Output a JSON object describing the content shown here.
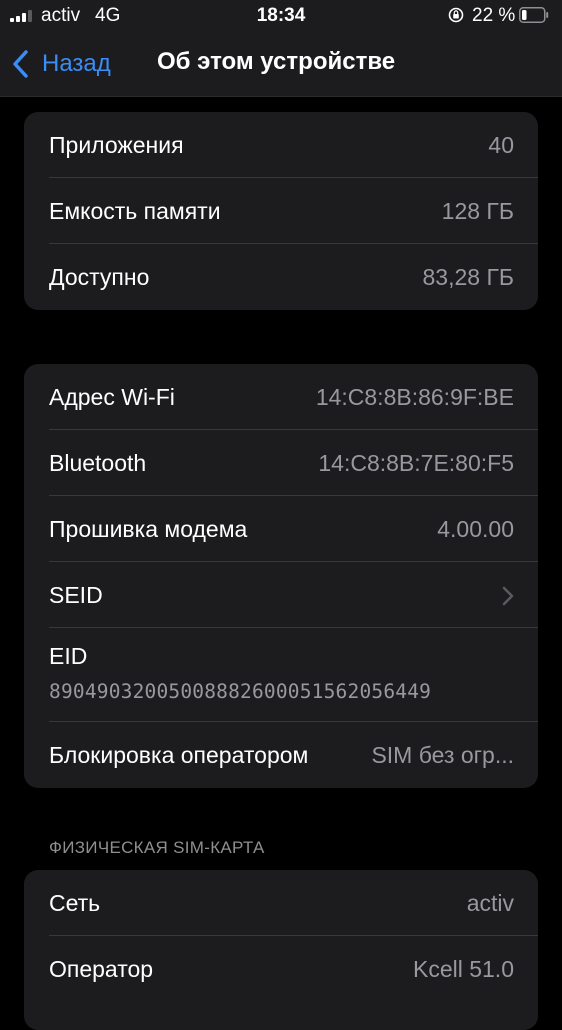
{
  "status_bar": {
    "carrier": "activ",
    "network": "4G",
    "time": "18:34",
    "battery": "22 %",
    "battery_level": 0.22,
    "signal_bars": 3,
    "lock_icon": "orientation-lock-icon"
  },
  "nav": {
    "back_label": "Назад",
    "title": "Об этом устройстве",
    "back_icon": "chevron-left-icon"
  },
  "group1": {
    "rows": [
      {
        "label": "Приложения",
        "value": "40"
      },
      {
        "label": "Емкость памяти",
        "value": "128 ГБ"
      },
      {
        "label": "Доступно",
        "value": "83,28 ГБ"
      }
    ]
  },
  "group2": {
    "rows": [
      {
        "label": "Адрес Wi-Fi",
        "value": "14:C8:8B:86:9F:BE"
      },
      {
        "label": "Bluetooth",
        "value": "14:C8:8B:7E:80:F5"
      },
      {
        "label": "Прошивка модема",
        "value": "4.00.00"
      },
      {
        "label": "SEID",
        "value": ""
      },
      {
        "label": "EID",
        "value": "89049032005008882600051562056449"
      },
      {
        "label": "Блокировка оператором",
        "value": "SIM без огр..."
      }
    ]
  },
  "sim_section": {
    "header": "ФИЗИЧЕСКАЯ SIM-КАРТА",
    "rows": [
      {
        "label": "Сеть",
        "value": "activ"
      },
      {
        "label": "Оператор",
        "value": "Kcell 51.0"
      }
    ]
  },
  "colors": {
    "accent": "#3b8cf6",
    "background": "#000000",
    "group_bg": "#1c1c1e",
    "secondary_text": "#98989f"
  }
}
